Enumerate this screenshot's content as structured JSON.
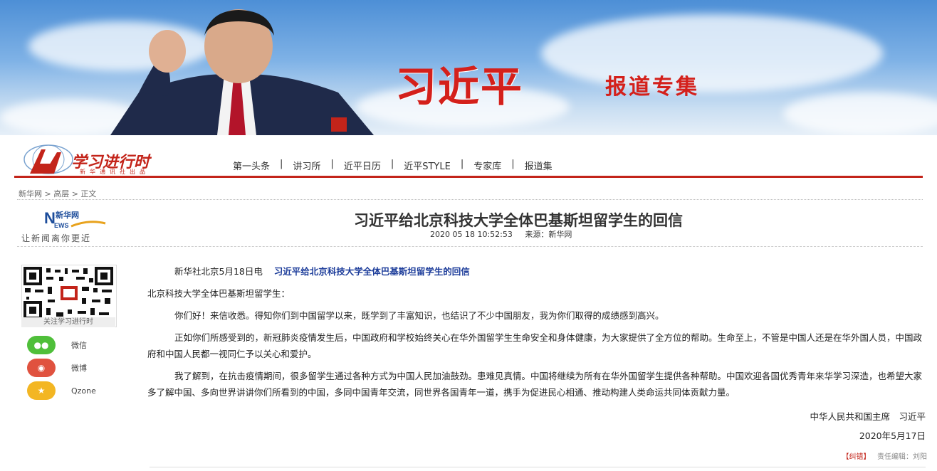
{
  "banner": {
    "title": "习近平",
    "subtitle": "报道专集"
  },
  "site": {
    "logo_text": "学习进行时",
    "logo_sub": "新华通讯社出品"
  },
  "nav": {
    "items": [
      "第一头条",
      "讲习所",
      "近平日历",
      "近平STYLE",
      "专家库",
      "报道集"
    ]
  },
  "breadcrumb": "新华网 > 高层 > 正文",
  "xinhua": {
    "logo": "新华网",
    "slogan": "让新闻离你更近"
  },
  "article": {
    "title": "习近平给北京科技大学全体巴基斯坦留学生的回信",
    "date": "2020 05 18 10:52:53",
    "source": "来源：新华网",
    "lead_prefix": "新华社北京5月18日电",
    "lead_link": "习近平给北京科技大学全体巴基斯坦留学生的回信",
    "salutation": "北京科技大学全体巴基斯坦留学生：",
    "p1": "你们好！来信收悉。得知你们到中国留学以来，既学到了丰富知识，也结识了不少中国朋友，我为你们取得的成绩感到高兴。",
    "p2": "正如你们所感受到的，新冠肺炎疫情发生后，中国政府和学校始终关心在华外国留学生生命安全和身体健康，为大家提供了全方位的帮助。生命至上，不管是中国人还是在华外国人员，中国政府和中国人民都一视同仁予以关心和爱护。",
    "p3": "我了解到，在抗击疫情期间，很多留学生通过各种方式为中国人民加油鼓劲。患难见真情。中国将继续为所有在华外国留学生提供各种帮助。中国欢迎各国优秀青年来华学习深造，也希望大家多了解中国、多向世界讲讲你们所看到的中国，多同中国青年交流，同世界各国青年一道，携手为促进民心相通、推动构建人类命运共同体贡献力量。",
    "signature": "中华人民共和国主席　习近平",
    "sign_date": "2020年5月17日",
    "error_tag": "【纠错】",
    "editor": "责任编辑：刘阳"
  },
  "sidebar": {
    "qr_label": "关注学习进行时",
    "share": [
      {
        "label": "微信",
        "icon": "wechat-icon",
        "color": "#4fbf3a"
      },
      {
        "label": "微博",
        "icon": "weibo-icon",
        "color": "#e0523f"
      },
      {
        "label": "Qzone",
        "icon": "qzone-icon",
        "color": "#f3b623"
      }
    ]
  }
}
